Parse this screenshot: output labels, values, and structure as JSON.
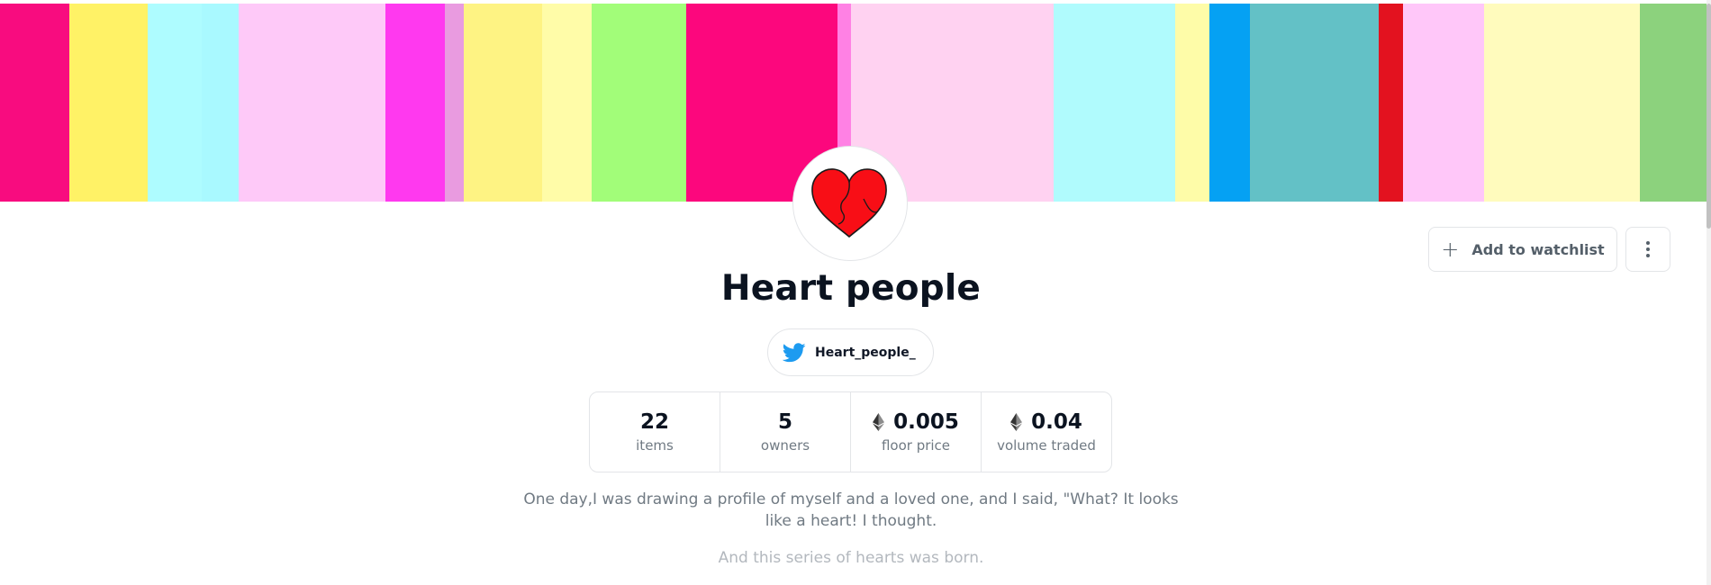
{
  "banner": {
    "stripe_colors": [
      "#f80c7f",
      "#fff266",
      "#aefcff",
      "#a9f9ff",
      "#fec9f8",
      "#ff39ef",
      "#e99be0",
      "#fef383",
      "#fffca8",
      "#a2fd79",
      "#fc077d",
      "#ff81e4",
      "#ffd2f1",
      "#b0fbfd",
      "#fefca8",
      "#05a1f3",
      "#63c1c6",
      "#e3121f",
      "#ffc7f9",
      "#fffbbd",
      "#8cd27d"
    ]
  },
  "collection": {
    "title": "Heart people",
    "avatar_icon": "heart-icon",
    "twitter_handle": "Heart_people_",
    "description": "One day,I was drawing a profile of myself and a loved one, and I said, \"What? It looks like a heart! I thought.",
    "description_faded": "And this series of hearts was born."
  },
  "stats": [
    {
      "value": "22",
      "label": "items",
      "eth": false
    },
    {
      "value": "5",
      "label": "owners",
      "eth": false
    },
    {
      "value": "0.005",
      "label": "floor price",
      "eth": true
    },
    {
      "value": "0.04",
      "label": "volume traded",
      "eth": true
    }
  ],
  "actions": {
    "watchlist_label": "Add to watchlist",
    "watchlist_icon": "plus-icon",
    "more_icon": "more-vertical-icon"
  },
  "colors": {
    "heart_red": "#f80e16",
    "twitter_blue": "#1d9bf0",
    "text_dark": "#0b1320",
    "text_muted": "#707a83"
  }
}
